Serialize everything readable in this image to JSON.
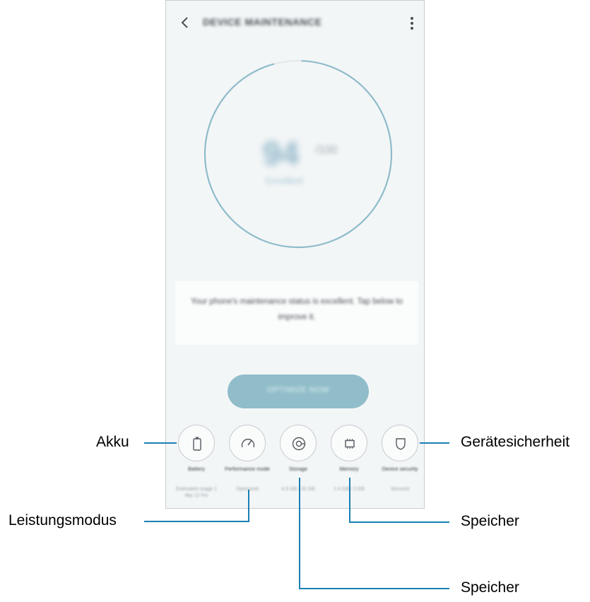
{
  "app": {
    "title": "DEVICE MAINTENANCE",
    "score": "94",
    "score_unit": "/100",
    "score_label": "Excellent",
    "status_message": "Your phone's maintenance status is excellent. Tap below to improve it.",
    "optimize_label": "OPTIMIZE NOW"
  },
  "tools": [
    {
      "label": "Battery",
      "value": "Estimated usage 1 day 12 hrs",
      "icon": "battery-icon"
    },
    {
      "label": "Performance mode",
      "value": "Optimized",
      "icon": "speedometer-icon"
    },
    {
      "label": "Storage",
      "value": "4.5 GB / 32 GB",
      "icon": "storage-icon"
    },
    {
      "label": "Memory",
      "value": "1.4 GB / 3 GB",
      "icon": "memory-chip-icon"
    },
    {
      "label": "Device security",
      "value": "Secured",
      "icon": "shield-icon"
    }
  ],
  "callouts": {
    "akku": "Akku",
    "leistungsmodus": "Leistungsmodus",
    "speicher_storage": "Speicher",
    "speicher_memory": "Speicher",
    "geraetesicherheit": "Gerätesicherheit"
  },
  "colors": {
    "accent": "#8fbccb",
    "callout_line": "#1a7fb5",
    "background": "#f3f6f7"
  }
}
